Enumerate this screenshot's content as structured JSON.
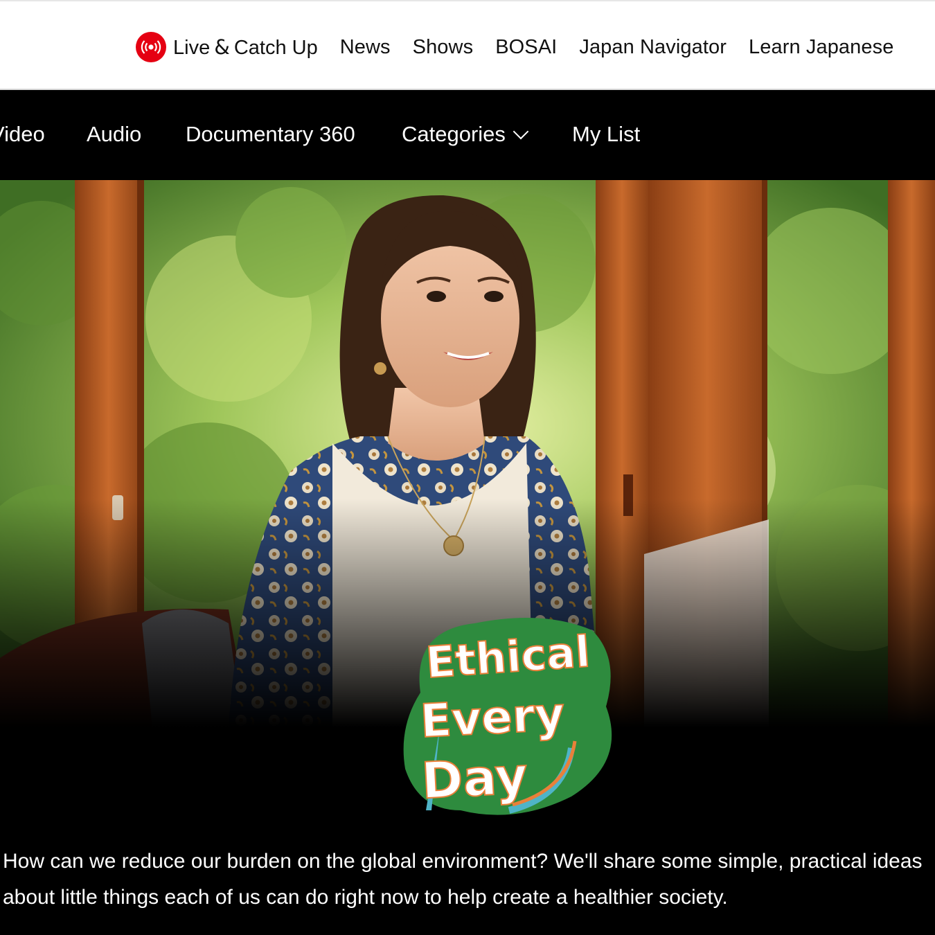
{
  "top_nav": {
    "live_label_part1": "Live",
    "live_label_amp": "&",
    "live_label_part2": "Catch Up",
    "items": [
      "News",
      "Shows",
      "BOSAI",
      "Japan Navigator",
      "Learn Japanese"
    ],
    "live_icon": "broadcast-icon",
    "live_color": "#e50012"
  },
  "sub_nav": {
    "items": [
      "Video",
      "Audio",
      "Documentary 360",
      "Categories",
      "My List"
    ],
    "categories_icon": "chevron-down-icon"
  },
  "hero": {
    "logo_lines": [
      "Ethical",
      "Every",
      "Day"
    ],
    "logo_colors": {
      "green": "#2e8b3e",
      "teal": "#4fb4c8",
      "orange": "#e9803a"
    }
  },
  "description": {
    "line1": "How can we reduce our burden on the global environment? We'll share some simple, practical ideas",
    "line2": "about little things each of us can do right now to help create a healthier society."
  }
}
